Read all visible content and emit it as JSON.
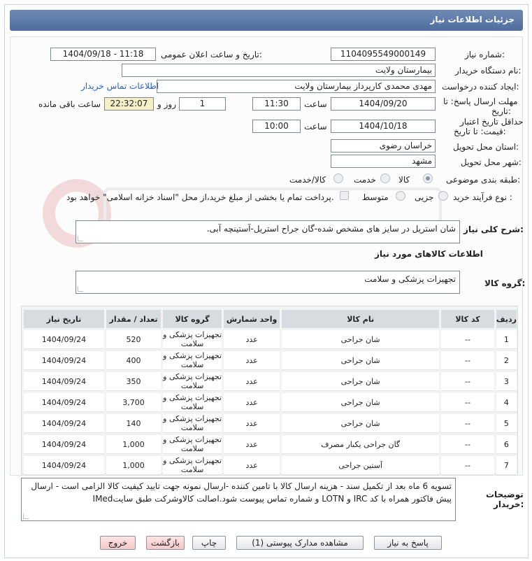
{
  "header": {
    "title": "جزئیات اطلاعات نیاز"
  },
  "form": {
    "need_number_label": "شماره نیاز:",
    "need_number": "1104095549000149",
    "announce_label": "تاریخ و ساعت اعلان عمومی:",
    "announce_value": "1404/09/18 - 11:18",
    "buyer_label": "نام دستگاه خریدار:",
    "buyer_value": "بیمارستان ولایت",
    "creator_label": "ایجاد کننده درخواست:",
    "creator_value": "مهدی محمدی کارپرداز بیمارستان ولایت",
    "contact_link": "اطلاعات تماس خریدار",
    "deadline_label_1": "مهلت ارسال پاسخ: تا",
    "deadline_label_2": "تاریخ:",
    "deadline_date": "1404/09/20",
    "time_label": "ساعت",
    "deadline_time": "11:30",
    "days_value": "1",
    "days_label": "روز و",
    "remaining_time": "22:32:07",
    "remaining_label": "ساعت باقی مانده",
    "validity_label_1": "حداقل تاریخ اعتبار",
    "validity_label_2": "قیمت: تا تاریخ:",
    "validity_date": "1404/10/18",
    "validity_time_label": "ساعت",
    "validity_time": "10:00",
    "province_label": "استان محل تحویل:",
    "province_value": "خراسان رضوی",
    "city_label": "شهر محل تحویل:",
    "city_value": "مشهد",
    "category_label": "طبقه بندی موضوعی:",
    "category_options": [
      "کالا",
      "خدمت",
      "کالا/خدمت"
    ],
    "category_selected": "کالا",
    "process_label": "نوع فرآیند خرید :",
    "process_options": [
      "جزیی",
      "متوسط"
    ],
    "process_note": "پرداخت تمام یا بخشی از مبلغ خرید،از محل \"اسناد خزانه اسلامی\" خواهد بود.",
    "description_label": "شرح کلی نیاز:",
    "description_value": "شان استریل در سایز های مشخص شده-گان جراح استریل-آستینچه آبی."
  },
  "goods": {
    "section_title": "اطلاعات کالاهای مورد نیاز",
    "group_label": "گروه کالا:",
    "group_value": "تجهیزات پزشکی و سلامت",
    "columns": [
      "ردیف",
      "کد کالا",
      "نام کالا",
      "واحد شمارش",
      "گروه کالا",
      "تعداد / مقدار",
      "تاریخ نیاز"
    ],
    "rows": [
      {
        "idx": "1",
        "code": "--",
        "name": "شان جراحی",
        "unit": "عدد",
        "group": "تجهیزات پزشکی و سلامت",
        "qty": "520",
        "date": "1404/09/24"
      },
      {
        "idx": "2",
        "code": "--",
        "name": "شان جراحی",
        "unit": "عدد",
        "group": "تجهیزات پزشکی و سلامت",
        "qty": "400",
        "date": "1404/09/24"
      },
      {
        "idx": "3",
        "code": "--",
        "name": "شان جراحی",
        "unit": "عدد",
        "group": "تجهیزات پزشکی و سلامت",
        "qty": "350",
        "date": "1404/09/24"
      },
      {
        "idx": "4",
        "code": "--",
        "name": "شان جراحی",
        "unit": "عدد",
        "group": "تجهیزات پزشکی و سلامت",
        "qty": "3,700",
        "date": "1404/09/24"
      },
      {
        "idx": "5",
        "code": "--",
        "name": "شان جراحی",
        "unit": "عدد",
        "group": "تجهیزات پزشکی و سلامت",
        "qty": "140",
        "date": "1404/09/24"
      },
      {
        "idx": "6",
        "code": "--",
        "name": "گان جراحی یکبار مصرف",
        "unit": "عدد",
        "group": "تجهیزات پزشکی و سلامت",
        "qty": "1,000",
        "date": "1404/09/24"
      },
      {
        "idx": "7",
        "code": "--",
        "name": "آستین جراحی",
        "unit": "عدد",
        "group": "تجهیزات پزشکی و سلامت",
        "qty": "1,000",
        "date": "1404/09/24"
      }
    ]
  },
  "notes": {
    "label_1": "توضیحات",
    "label_2": "خریدار:",
    "value": "تسویه 6 ماه بعد از تکمیل سند - هزینه ارسال کالا با تامین کننده -ارسال نمونه جهت تایید کیفیت کالا الزامی است - ارسال پیش فاکتور همراه با کد IRC و LOTN و شماره تماس پیوست شود.اصالت کالاوشرکت طبق سایتIMed"
  },
  "buttons": {
    "reply": "پاسخ به نیاز",
    "docs": "مشاهده مدارک پیوستی (1)",
    "print": "چاپ",
    "back": "بازگشت",
    "exit": "خروج"
  },
  "colors": {
    "header": "#5b79a8",
    "link": "#2a62c9",
    "highlight": "#f5f0c8"
  }
}
